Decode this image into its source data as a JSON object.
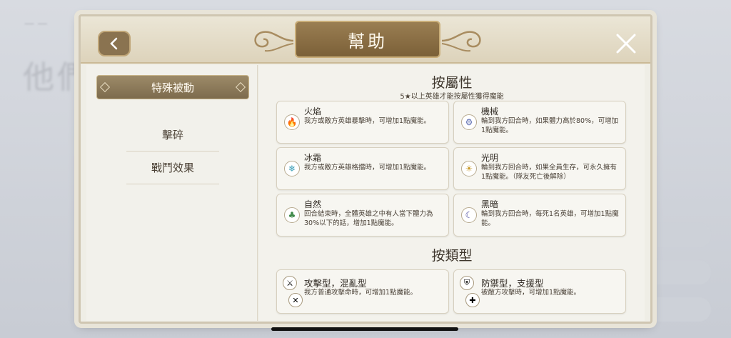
{
  "header": {
    "title": "幫助"
  },
  "sidebar": {
    "items": [
      {
        "label": "特殊被動"
      },
      {
        "label": "擊碎"
      },
      {
        "label": "戰鬥效果"
      }
    ]
  },
  "attribute_section": {
    "title": "按屬性",
    "subtitle": "5★以上英雄才能按屬性獲得魔能",
    "cards": [
      {
        "title": "火焰",
        "desc": "我方或敵方英雄暴擊時，可增加1點魔能。",
        "icon": "fire-icon",
        "color": "#c0432c"
      },
      {
        "title": "機械",
        "desc": "輪到我方回合時，如果體力高於80%，可增加1點魔能。",
        "icon": "gear-icon",
        "color": "#5a6ab0"
      },
      {
        "title": "冰霜",
        "desc": "我方或敵方英雄格擋時，可增加1點魔能。",
        "icon": "snowflake-icon",
        "color": "#3fa0b8"
      },
      {
        "title": "光明",
        "desc": "輪到我方回合時，如果全員生存，可永久擁有1點魔能。（隊友死亡後解除）",
        "icon": "sun-icon",
        "color": "#c99a2a"
      },
      {
        "title": "自然",
        "desc": "回合結束時，全體英雄之中有人當下體力為30%以下的話，增加1點魔能。",
        "icon": "leaf-icon",
        "color": "#3f8a4a"
      },
      {
        "title": "黑暗",
        "desc": "輪到我方回合時，每死1名英雄，可增加1點魔能。",
        "icon": "moon-icon",
        "color": "#4a4aa0"
      }
    ]
  },
  "type_section": {
    "title": "按類型",
    "cards": [
      {
        "title": "攻擊型，混亂型",
        "desc": "我方普通攻擊命時，可增加1點魔能。",
        "icons": [
          "sword-icon",
          "crossed-swords-icon"
        ]
      },
      {
        "title": "防禦型，支援型",
        "desc": "被敵方攻擊時，可增加1點魔能。",
        "icons": [
          "shield-icon",
          "cross-icon"
        ]
      }
    ]
  }
}
